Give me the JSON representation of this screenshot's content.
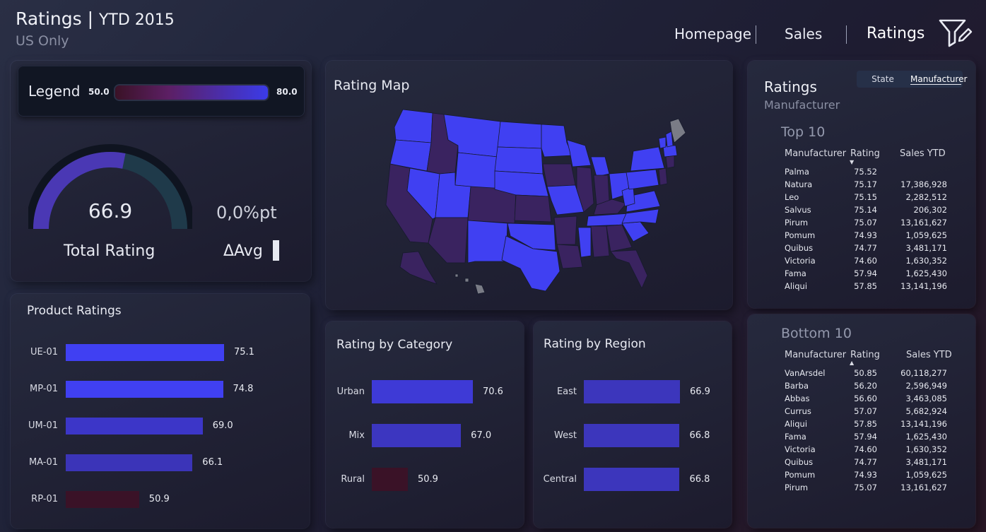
{
  "header": {
    "title": "Ratings",
    "title_sep": "|",
    "period": "YTD 2015",
    "subtitle": "US Only",
    "nav": [
      "Homepage",
      "Sales",
      "Ratings"
    ],
    "active_nav": "Ratings"
  },
  "legend": {
    "label": "Legend",
    "min": "50.0",
    "max": "80.0"
  },
  "gauge": {
    "value": "66.9",
    "value_num": 66.9,
    "min": 50,
    "max": 80,
    "label": "Total Rating"
  },
  "delta": {
    "value": "0,0%pt",
    "label": "ΔAvg"
  },
  "rating_map": {
    "title": "Rating Map"
  },
  "product_ratings": {
    "title": "Product Ratings",
    "items": [
      {
        "label": "UE-01",
        "value": 75.1,
        "display": "75.1",
        "color": "#4040f2"
      },
      {
        "label": "MP-01",
        "value": 74.8,
        "display": "74.8",
        "color": "#4040f2"
      },
      {
        "label": "UM-01",
        "value": 69.0,
        "display": "69.0",
        "color": "#3c36c8"
      },
      {
        "label": "MA-01",
        "value": 66.1,
        "display": "66.1",
        "color": "#3b34b8"
      },
      {
        "label": "RP-01",
        "value": 50.9,
        "display": "50.9",
        "color": "#3a1227"
      }
    ]
  },
  "category": {
    "title": "Rating by Category",
    "items": [
      {
        "label": "Urban",
        "value": 70.6,
        "display": "70.6",
        "color": "#3e3ad6"
      },
      {
        "label": "Mix",
        "value": 67.0,
        "display": "67.0",
        "color": "#3c36c0"
      },
      {
        "label": "Rural",
        "value": 50.9,
        "display": "50.9",
        "color": "#3a1227"
      }
    ]
  },
  "region": {
    "title": "Rating by Region",
    "items": [
      {
        "label": "East",
        "value": 66.9,
        "display": "66.9",
        "color": "#3c36bc"
      },
      {
        "label": "West",
        "value": 66.8,
        "display": "66.8",
        "color": "#3c36bc"
      },
      {
        "label": "Central",
        "value": 66.8,
        "display": "66.8",
        "color": "#3c36bc"
      }
    ]
  },
  "ratings_panel": {
    "title": "Ratings",
    "subtitle": "Manufacturer",
    "toggle": [
      "State",
      "Manufacturer"
    ],
    "active_toggle": "Manufacturer",
    "top10": {
      "title": "Top 10",
      "columns": [
        "Manufacturer",
        "Rating",
        "Sales YTD"
      ],
      "rows": [
        [
          "Palma",
          "75.52",
          ""
        ],
        [
          "Natura",
          "75.17",
          "17,386,928"
        ],
        [
          "Leo",
          "75.15",
          "2,282,512"
        ],
        [
          "Salvus",
          "75.14",
          "206,302"
        ],
        [
          "Pirum",
          "75.07",
          "13,161,627"
        ],
        [
          "Pomum",
          "74.93",
          "1,059,625"
        ],
        [
          "Quibus",
          "74.77",
          "3,481,171"
        ],
        [
          "Victoria",
          "74.60",
          "1,630,352"
        ],
        [
          "Fama",
          "57.94",
          "1,625,430"
        ],
        [
          "Aliqui",
          "57.85",
          "13,141,196"
        ]
      ]
    },
    "bottom10": {
      "title": "Bottom 10",
      "columns": [
        "Manufacturer",
        "Rating",
        "Sales YTD"
      ],
      "rows": [
        [
          "VanArsdel",
          "50.85",
          "60,118,277"
        ],
        [
          "Barba",
          "56.20",
          "2,596,949"
        ],
        [
          "Abbas",
          "56.60",
          "3,463,085"
        ],
        [
          "Currus",
          "57.07",
          "5,682,924"
        ],
        [
          "Aliqui",
          "57.85",
          "13,141,196"
        ],
        [
          "Fama",
          "57.94",
          "1,625,430"
        ],
        [
          "Victoria",
          "74.60",
          "1,630,352"
        ],
        [
          "Quibus",
          "74.77",
          "3,481,171"
        ],
        [
          "Pomum",
          "74.93",
          "1,059,625"
        ],
        [
          "Pirum",
          "75.07",
          "13,161,627"
        ]
      ]
    }
  },
  "colors": {
    "high": "#4040f2",
    "mid": "#3c36c0",
    "low": "#3a1227",
    "purple": "#3a2360",
    "grey": "#7a7c86"
  }
}
